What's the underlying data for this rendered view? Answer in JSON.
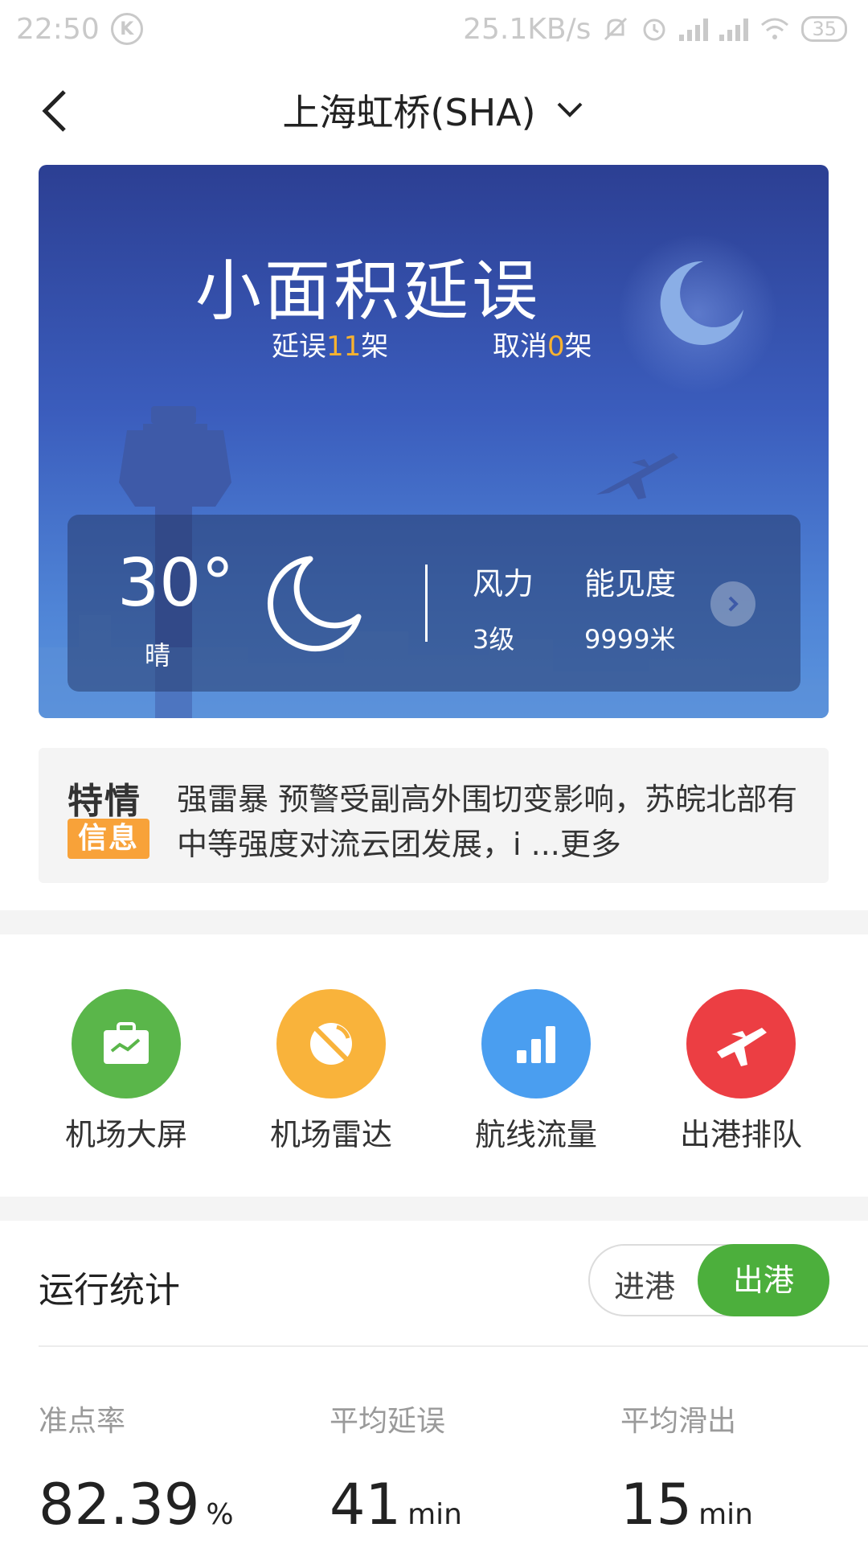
{
  "status_bar": {
    "time": "22:50",
    "k_badge": "K",
    "network_speed": "25.1KB/s",
    "battery": "35"
  },
  "header": {
    "title": "上海虹桥(SHA)"
  },
  "hero": {
    "status_title": "小面积延误",
    "delay_prefix": "延误",
    "delay_count": "11",
    "delay_suffix": "架",
    "cancel_prefix": "取消",
    "cancel_count": "0",
    "cancel_suffix": "架",
    "weather": {
      "temperature": "30°",
      "condition": "晴",
      "wind_label": "风力",
      "wind_value": "3级",
      "visibility_label": "能见度",
      "visibility_value": "9999米"
    }
  },
  "special_info": {
    "badge_top": "特情",
    "badge_bottom": "信息",
    "text": "强雷暴 预警受副高外围切变影响，苏皖北部有中等强度对流云团发展，i ...",
    "more": "更多"
  },
  "shortcuts": [
    {
      "label": "机场大屏",
      "color": "#5ab64a"
    },
    {
      "label": "机场雷达",
      "color": "#f9b33b"
    },
    {
      "label": "航线流量",
      "color": "#4a9ef0"
    },
    {
      "label": "出港排队",
      "color": "#ec3e43"
    }
  ],
  "stats": {
    "title": "运行统计",
    "toggle_in": "进港",
    "toggle_out": "出港",
    "selected": "出港",
    "items": [
      {
        "label": "准点率",
        "value": "82.39",
        "unit": "%"
      },
      {
        "label": "平均延误",
        "value": "41",
        "unit": "min"
      },
      {
        "label": "平均滑出",
        "value": "15",
        "unit": "min"
      }
    ]
  },
  "colors": {
    "accent_green": "#4caf3c",
    "highlight_orange": "#f8b230"
  }
}
